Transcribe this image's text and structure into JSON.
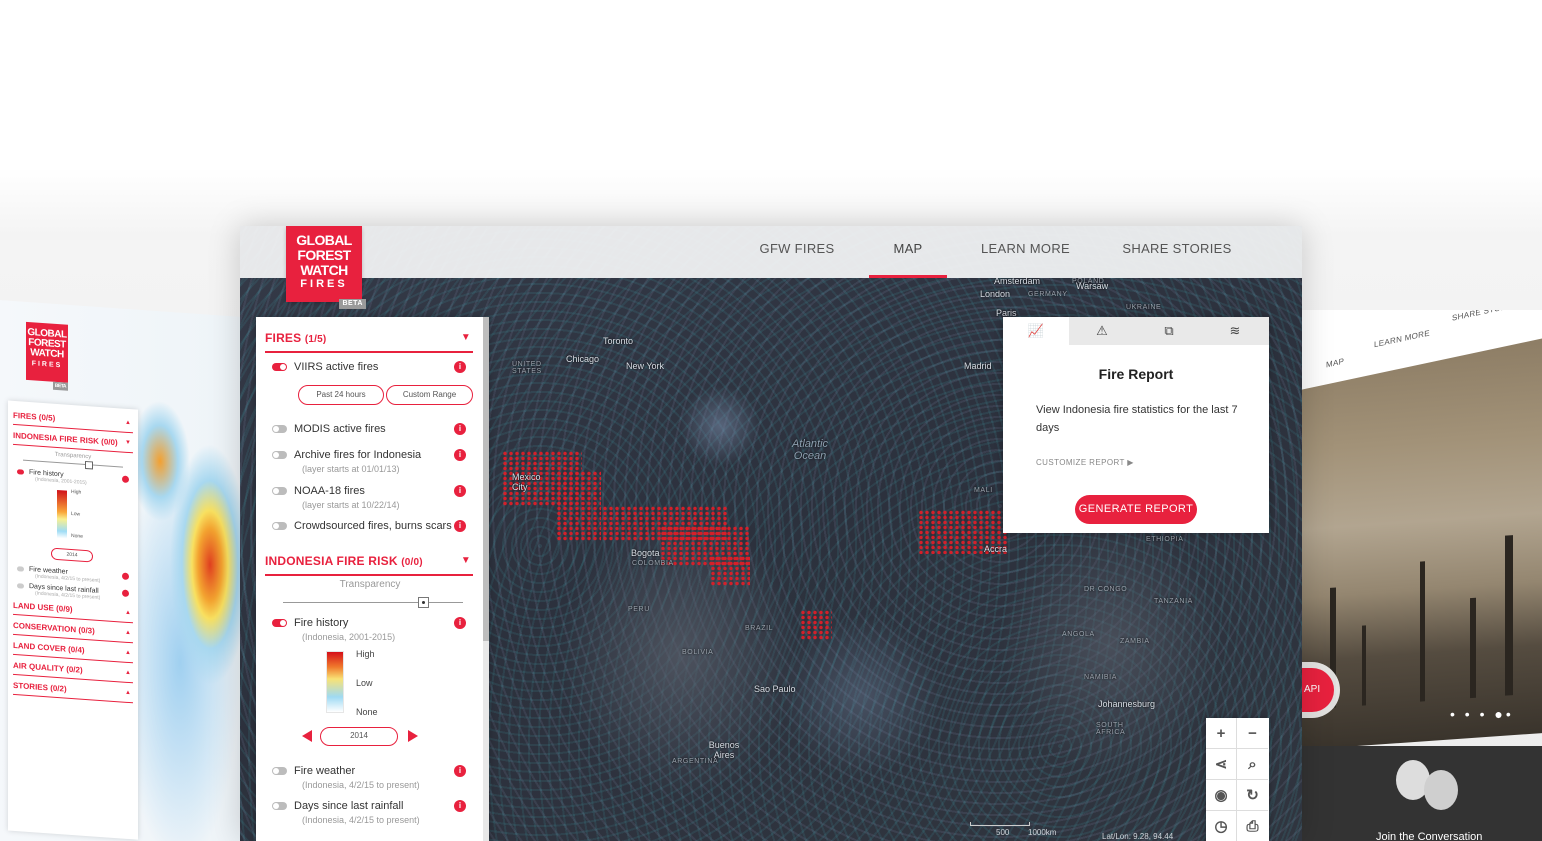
{
  "left_mock": {
    "logo": [
      "GLOBAL",
      "FOREST",
      "WATCH",
      "FIRES"
    ],
    "beta": "BETA",
    "sections": [
      {
        "label": "FIRES (0/5)"
      },
      {
        "label": "INDONESIA FIRE RISK (0/0)"
      },
      {
        "label": "LAND USE (0/9)"
      },
      {
        "label": "CONSERVATION (0/3)"
      },
      {
        "label": "LAND COVER (0/4)"
      },
      {
        "label": "AIR QUALITY (0/2)"
      },
      {
        "label": "STORIES (0/2)"
      }
    ],
    "transparency": "Transparency",
    "fire_history": "Fire history",
    "fire_history_sub": "(Indonesia, 2001-2015)",
    "legend": {
      "high": "High",
      "low": "Low",
      "none": "None"
    },
    "year": "2014",
    "fire_weather": "Fire weather",
    "fire_weather_sub": "(Indonesia, 4/2/15 to present)",
    "days_rainfall": "Days since last rainfall",
    "days_rainfall_sub": "(Indonesia, 4/2/15 to present)"
  },
  "header": {
    "logo": {
      "line1": "GLOBAL",
      "line2": "FOREST",
      "line3": "WATCH",
      "line4": "FIRES",
      "beta": "BETA"
    },
    "nav": [
      "GFW FIRES",
      "MAP",
      "LEARN MORE",
      "SHARE STORIES"
    ],
    "active_nav": "MAP"
  },
  "panel": {
    "fires_section": {
      "label": "FIRES",
      "count": "(1/5)"
    },
    "layers": [
      {
        "label": "VIIRS active fires",
        "on": true
      },
      {
        "label": "MODIS active fires",
        "on": false
      },
      {
        "label": "Archive fires for Indonesia",
        "on": false,
        "sub": "(layer starts at 01/01/13)"
      },
      {
        "label": "NOAA-18 fires",
        "on": false,
        "sub": "(layer starts at 10/22/14)"
      },
      {
        "label": "Crowdsourced fires, burns scars",
        "on": false
      }
    ],
    "buttons": [
      "Past 24 hours",
      "Custom Range"
    ],
    "risk_section": {
      "label": "INDONESIA FIRE RISK",
      "count": "(0/0)"
    },
    "transparency": "Transparency",
    "fire_history": {
      "label": "Fire history",
      "sub": "(Indonesia, 2001-2015)"
    },
    "legend": {
      "high": "High",
      "low": "Low",
      "none": "None"
    },
    "year": "2014",
    "fire_weather": {
      "label": "Fire weather",
      "sub": "(Indonesia, 4/2/15 to present)"
    },
    "days_rainfall": {
      "label": "Days since last rainfall",
      "sub": "(Indonesia, 4/2/15 to present)"
    }
  },
  "report": {
    "tabs": [
      "chart-icon",
      "alert-icon",
      "analysis-icon",
      "layers-icon"
    ],
    "title": "Fire Report",
    "text": "View Indonesia fire statistics for the last 7 days",
    "customize": "CUSTOMIZE REPORT ▶",
    "button": "GENERATE REPORT"
  },
  "map_labels": {
    "toronto": "Toronto",
    "chicago": "Chicago",
    "new_york": "New York",
    "united_states": "UNITED STATES",
    "mexico_city": "Mexico City",
    "atlantic": "Atlantic Ocean",
    "bogota": "Bogota",
    "colombia": "COLOMBIA",
    "peru": "PERU",
    "brazil": "BRAZIL",
    "bolivia": "BOLIVIA",
    "sao_paulo": "Sao Paulo",
    "buenos_aires": "Buenos Aires",
    "argentina": "ARGENTINA",
    "amsterdam": "Amsterdam",
    "london": "London",
    "germany": "GERMANY",
    "warsaw": "Warsaw",
    "poland": "POLAND",
    "ukraine": "UKRAINE",
    "paris": "Paris",
    "madrid": "Madrid",
    "mali": "MALI",
    "accra": "Accra",
    "ethiopia": "ETHIOPIA",
    "dr_congo": "DR CONGO",
    "tanzania": "TANZANIA",
    "angola": "ANGOLA",
    "zambia": "ZAMBIA",
    "namibia": "NAMIBIA",
    "johannesburg": "Johannesburg",
    "south_africa": "SOUTH AFRICA",
    "scale_500": "500",
    "scale_1000": "1000km",
    "latlon": "Lat/Lon: 9.28, 94.44"
  },
  "controls": [
    "zoom-in-icon",
    "zoom-out-icon",
    "share-icon",
    "search-icon",
    "eye-icon",
    "refresh-icon",
    "clock-icon",
    "print-icon"
  ],
  "right_mock": {
    "nav": [
      "MAP",
      "LEARN MORE",
      "SHARE STORIES"
    ],
    "pill": "API",
    "join": "Join the Conversation"
  },
  "colors": {
    "accent": "#e8213e",
    "map_bg": "#2e333e"
  }
}
